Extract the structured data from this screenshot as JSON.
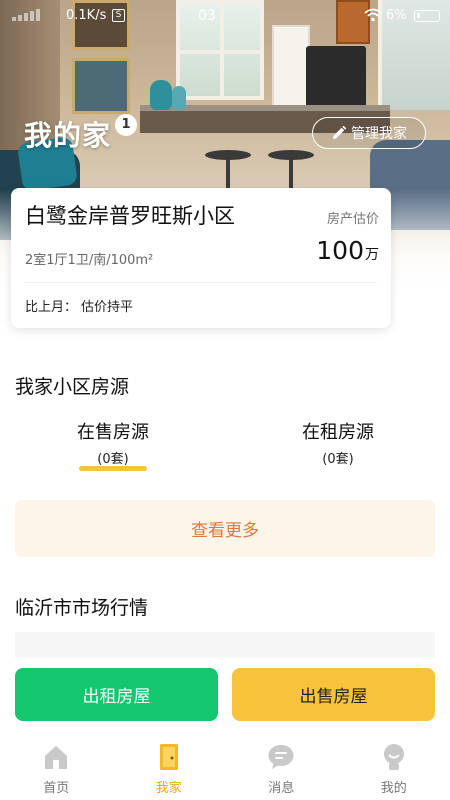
{
  "status_bar": {
    "network_speed": "0.1K/s",
    "data_icon_glyph": "S",
    "time": "03",
    "battery_percent": "6%"
  },
  "header": {
    "title": "我的家",
    "badge_count": "1",
    "manage_label": "管理我家"
  },
  "property": {
    "name": "白鹭金岸普罗旺斯小区",
    "detail": "2室1厅1卫/南/100m²",
    "price_label": "房产估价",
    "price_value": "100",
    "price_unit": "万",
    "compare_label": "比上月：",
    "compare_value": "估价持平"
  },
  "listings": {
    "title": "我家小区房源",
    "tabs": [
      {
        "label": "在售房源",
        "count": "(0套)",
        "active": true
      },
      {
        "label": "在租房源",
        "count": "(0套)",
        "active": false
      }
    ],
    "more_label": "查看更多"
  },
  "market": {
    "title": "临沂市市场行情"
  },
  "actions": {
    "rent_label": "出租房屋",
    "sell_label": "出售房屋"
  },
  "bottom_nav": {
    "items": [
      {
        "label": "首页",
        "icon": "home-icon",
        "active": false
      },
      {
        "label": "我家",
        "icon": "door-icon",
        "active": true
      },
      {
        "label": "消息",
        "icon": "message-icon",
        "active": false
      },
      {
        "label": "我的",
        "icon": "profile-icon",
        "active": false
      }
    ]
  },
  "colors": {
    "accent_yellow": "#f7c33c",
    "rent_green": "#14c76e",
    "sell_yellow": "#f8c33b",
    "more_text_orange": "#e4763a",
    "nav_active": "#e8a71a",
    "nav_inactive": "#c9c9c9"
  }
}
